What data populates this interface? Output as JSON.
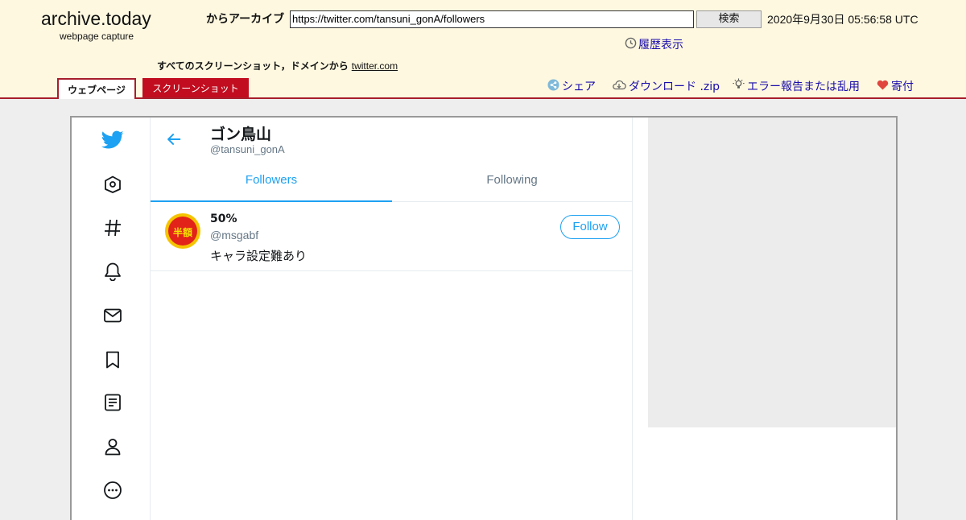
{
  "archive": {
    "brand_title": "archive.today",
    "brand_subtitle": "webpage capture",
    "from_label": "からアーカイブ",
    "url": "https://twitter.com/tansuni_gonA/followers",
    "search_label": "検索",
    "capture_date": "2020年9月30日 05:56:58 UTC",
    "history_label": "履歴表示",
    "all_shots_label": "すべてのスクリーンショット，ドメインから",
    "domain_link": "twitter.com",
    "tab_webpage": "ウェブページ",
    "tab_screenshot": "スクリーンショット",
    "actions": {
      "share": "シェア",
      "download": "ダウンロード .zip",
      "report": "エラー報告または乱用",
      "donate": "寄付"
    }
  },
  "twitter": {
    "nav_icons": [
      "twitter-bird-icon",
      "home-icon",
      "hashtag-icon",
      "bell-icon",
      "envelope-icon",
      "bookmark-icon",
      "list-icon",
      "profile-icon",
      "more-icon"
    ],
    "profile": {
      "name": "ゴン鳥山",
      "handle": "@tansuni_gonA"
    },
    "tabs": [
      {
        "label": "Followers",
        "active": true
      },
      {
        "label": "Following",
        "active": false
      }
    ],
    "followers": [
      {
        "name": "50%",
        "handle": "@msgabf",
        "bio": "キャラ設定難あり",
        "avatar_text": "半額",
        "follow_label": "Follow"
      }
    ]
  },
  "colors": {
    "twitter_blue": "#1da1f2",
    "archive_red": "#c10d1f",
    "header_bg": "#fef8e0"
  }
}
